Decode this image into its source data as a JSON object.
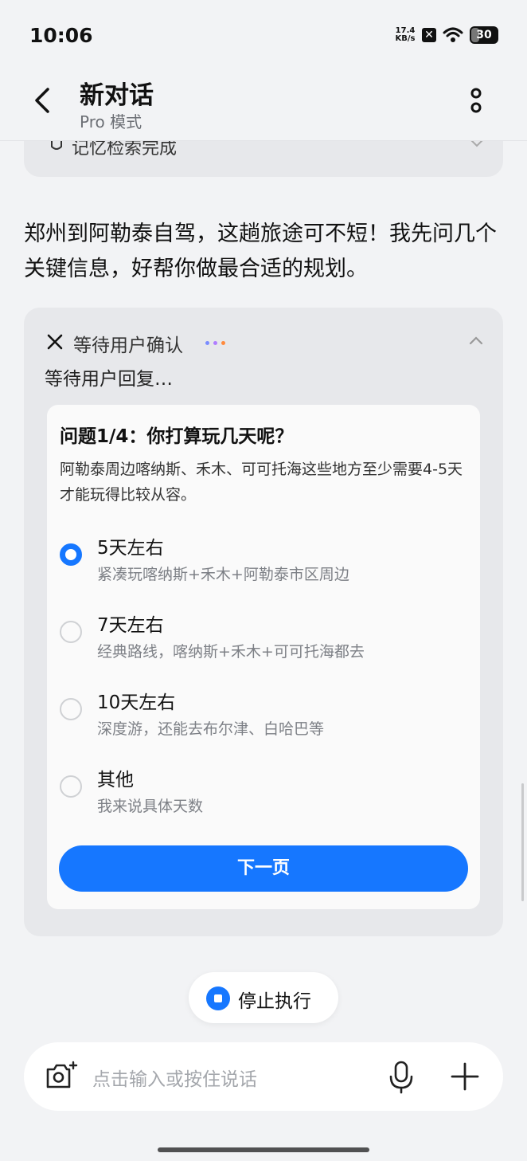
{
  "status_bar": {
    "time": "10:06",
    "net_speed_value": "17.4",
    "net_speed_unit": "KB/s",
    "battery": "30"
  },
  "header": {
    "title": "新对话",
    "subtitle": "Pro 模式"
  },
  "previous_step": {
    "label": "记忆检索完成"
  },
  "answer": {
    "text": "郑州到阿勒泰自驾，这趟旅途可不短！我先问几个关键信息，好帮你做最合适的规划。"
  },
  "task": {
    "title": "等待用户确认",
    "status": "等待用户回复…",
    "dot_colors": [
      "#7a8cff",
      "#b07dff",
      "#ff8a3d"
    ],
    "question": {
      "title": "问题1/4：你打算玩几天呢？",
      "description": "阿勒泰周边喀纳斯、禾木、可可托海这些地方至少需要4-5天才能玩得比较从容。",
      "selected_index": 0,
      "options": [
        {
          "label": "5天左右",
          "sub": "紧凑玩喀纳斯+禾木+阿勒泰市区周边"
        },
        {
          "label": "7天左右",
          "sub": "经典路线，喀纳斯+禾木+可可托海都去"
        },
        {
          "label": "10天左右",
          "sub": "深度游，还能去布尔津、白哈巴等"
        },
        {
          "label": "其他",
          "sub": "我来说具体天数"
        }
      ],
      "next_button": "下一页"
    }
  },
  "stop_button": "停止执行",
  "input": {
    "placeholder": "点击输入或按住说话"
  },
  "colors": {
    "accent": "#1677ff",
    "background": "#f2f3f5",
    "card": "#e7e8eb"
  }
}
